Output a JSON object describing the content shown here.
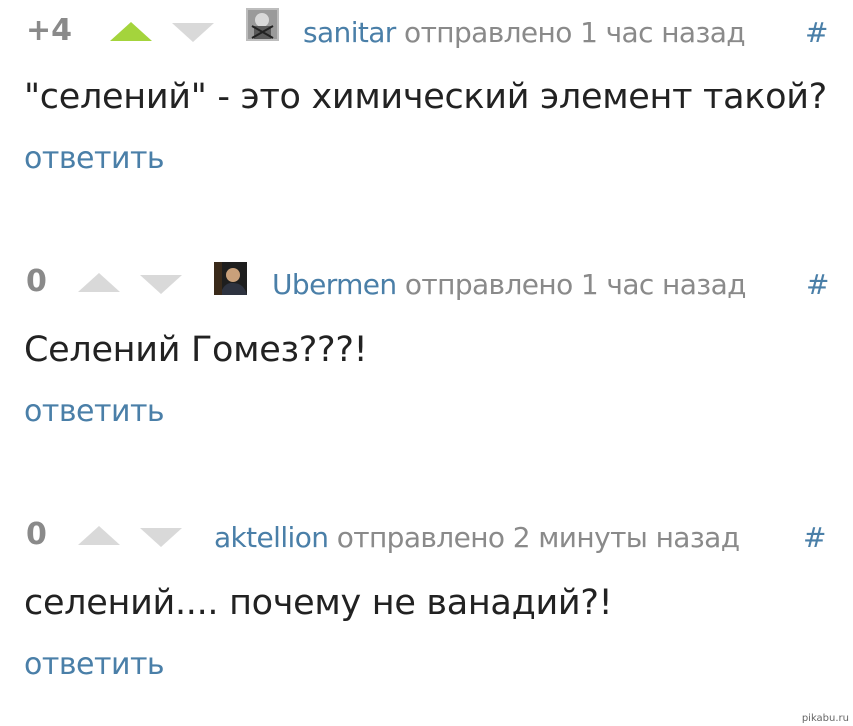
{
  "comments": [
    {
      "score": "+4",
      "author": "sanitar",
      "sent": "отправлено 1 час назад",
      "permalink": "#",
      "text": "\"селений\" - это химический элемент такой?",
      "reply": "ответить",
      "vote_up_active": true,
      "avatar": "avatar-grayscale-icon"
    },
    {
      "score": "0",
      "author": "Ubermen",
      "sent": "отправлено 1 час назад",
      "permalink": "#",
      "text": "Селений Гомез???!",
      "reply": "ответить",
      "vote_up_active": false,
      "avatar": "avatar-photo-icon"
    },
    {
      "score": "0",
      "author": "aktellion",
      "sent": "отправлено 2 минуты назад",
      "permalink": "#",
      "text": "селений.... почему не ванадий?!",
      "reply": "ответить",
      "vote_up_active": false,
      "avatar": null
    }
  ],
  "watermark": "pikabu.ru",
  "colors": {
    "link": "#4a7fa8",
    "muted": "#8a8a8a",
    "vote_active": "#a4d43c",
    "vote_inactive": "#d9d9d9"
  }
}
